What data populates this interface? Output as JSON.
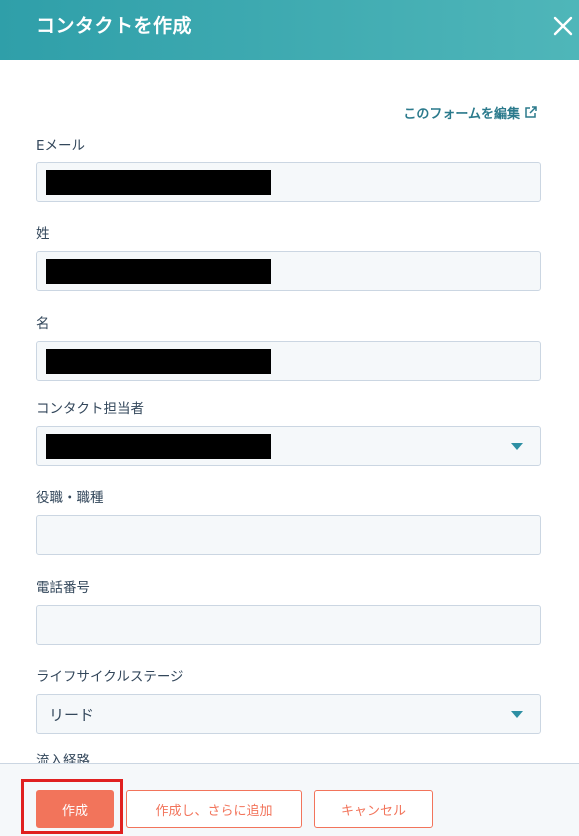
{
  "header": {
    "title": "コンタクトを作成",
    "close_icon": "close-icon"
  },
  "form": {
    "edit_link": "このフォームを編集",
    "fields": [
      {
        "label": "Eメール"
      },
      {
        "label": "姓"
      },
      {
        "label": "名"
      },
      {
        "label": "コンタクト担当者"
      },
      {
        "label": "役職・職種"
      },
      {
        "label": "電話番号"
      },
      {
        "label": "ライフサイクルステージ",
        "value": "リード"
      },
      {
        "label": "流入経路"
      }
    ]
  },
  "footer": {
    "create_label": "作成",
    "create_more_label": "作成し、さらに追加",
    "cancel_label": "キャンセル"
  },
  "colors": {
    "header": "#2f9fa9",
    "accent": "#f2745b",
    "link": "#2b7a8c",
    "highlight": "#e02020"
  }
}
